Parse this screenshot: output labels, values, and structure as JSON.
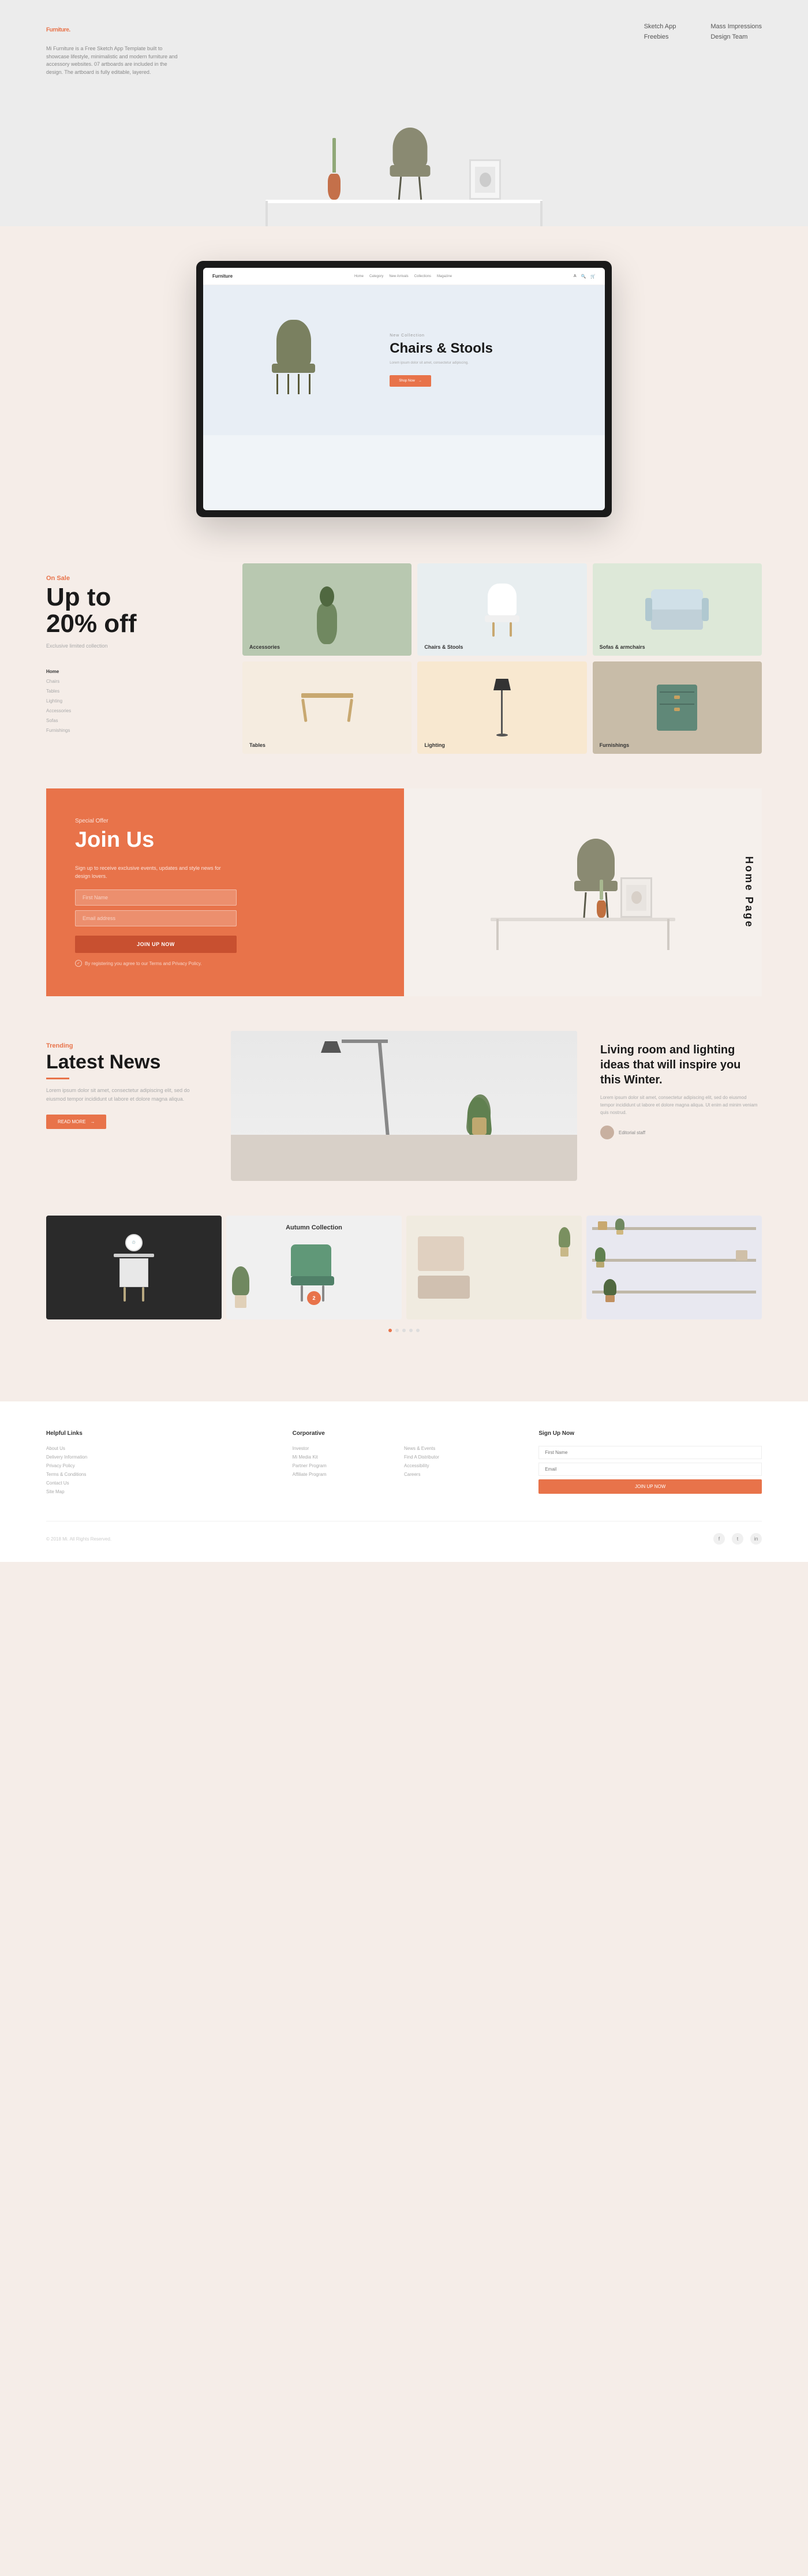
{
  "brand": {
    "name": "Furniture",
    "tagmark": ".",
    "description": "Mi Furniture is a Free Sketch App Template built to showcase lifestyle, minimalistic and modern furniture and accessory websites. 07 artboards are included in the design. The artboard is fully editable, layered."
  },
  "nav": {
    "links_col1": [
      "Sketch App",
      "Freebies"
    ],
    "links_col2": [
      "Mass Impressions",
      "Design Team"
    ]
  },
  "inner_website": {
    "brand": "Furniture",
    "nav_links": [
      "Home",
      "Category",
      "New Arrivals",
      "Collections",
      "Magazine"
    ],
    "hero_label": "New Collection",
    "hero_title_line1": "Chairs & Stools",
    "hero_subtitle": "Lorem ipsum dolor sit amet, consectetur adipiscing.",
    "hero_cta": "Shop Now"
  },
  "sale": {
    "tag": "On Sale",
    "headline_line1": "Up to",
    "headline_line2": "20% off",
    "description": "Exclusive limited collection",
    "sidebar_items": [
      "Home",
      "Chairs",
      "Tables",
      "Lighting",
      "Accessories",
      "Sofas",
      "Furnishings"
    ],
    "categories": [
      {
        "label": "Accessories",
        "color": "accessories"
      },
      {
        "label": "Chairs & Stools",
        "color": "chairs"
      },
      {
        "label": "Sofas & armchairs",
        "color": "sofas"
      },
      {
        "label": "Tables",
        "color": "tables"
      },
      {
        "label": "Lighting",
        "color": "lighting"
      },
      {
        "label": "Furnishings",
        "color": "furnishings"
      }
    ]
  },
  "special_offer": {
    "tag": "Special Offer",
    "title": "Join Us",
    "description": "Sign up to receive exclusive events, updates and style news for design lovers.",
    "name_placeholder": "First Name",
    "email_placeholder": "Email address",
    "cta": "JOIN UP NOW",
    "privacy_note": "By registering you agree to our Terms and Privacy Policy."
  },
  "home_page_label": "Home Page",
  "news": {
    "tag": "Trending",
    "headline": "Latest News",
    "excerpt": "Lorem ipsum dolor sit amet, consectetur adipiscing elit, sed do eiusmod tempor incididunt ut labore et dolore magna aliqua.",
    "read_more": "READ MORE",
    "right_title": "Living room and lighting ideas that will inspire you this Winter.",
    "right_text": "Lorem ipsum dolor sit amet, consectetur adipiscing elit, sed do eiusmod tempor incididunt ut labore et dolore magna aliqua. Ut enim ad minim veniam quis nostrud.",
    "author": "Editorial staff"
  },
  "autumn": {
    "title": "Autumn Collection",
    "cards": [
      {
        "label": "",
        "theme": "dark"
      },
      {
        "label": "Autumn Collection",
        "theme": "white"
      },
      {
        "label": "",
        "theme": "cream"
      },
      {
        "label": "",
        "theme": "light"
      }
    ],
    "badge_text": "2"
  },
  "footer": {
    "col1_title": "Helpful Links",
    "col1_links": [
      "About Us",
      "Delivery Information",
      "Privacy Policy",
      "Terms & Conditions",
      "Contact Us",
      "Site Map"
    ],
    "col2_title": "Corporative",
    "col2_links_col1": [
      "Investor",
      "Mi Media Kit",
      "Partner Program",
      "Affiliate Program"
    ],
    "col2_links_col2": [
      "News & Events",
      "Find A Distributor",
      "Accessibility",
      "Careers"
    ],
    "col3_title": "Sign Up Now",
    "col3_placeholder1": "First Name",
    "col3_placeholder2": "Email",
    "col3_cta": "JOIN UP NOW",
    "copyright": "© 2018 Mi. All Rights Reserved.",
    "social_icons": [
      "f",
      "t",
      "in"
    ]
  }
}
